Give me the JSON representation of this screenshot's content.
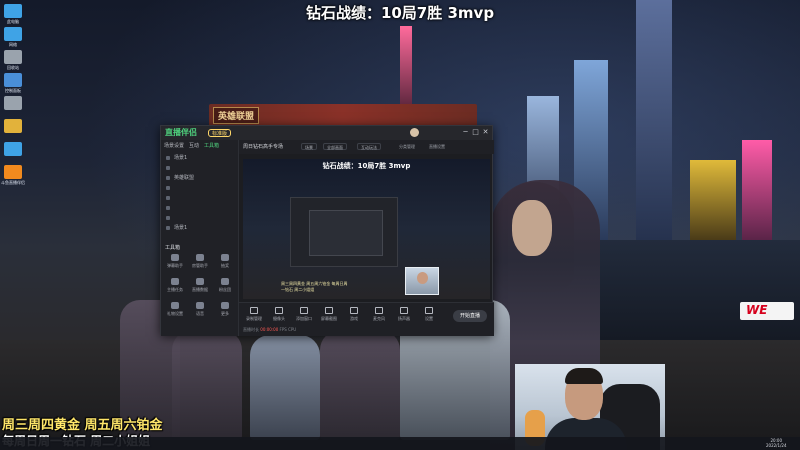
{
  "overlay": {
    "top_title": "钻石战绩：10局7胜  3mvp",
    "promo_line1": "周三周四黄金 周五周六铂金",
    "promo_line2": "每周日周一钻石 周二小姐姐"
  },
  "desktop": {
    "icons": [
      {
        "label": "此电脑",
        "color": "#3fa3e6"
      },
      {
        "label": "网络",
        "color": "#3fa3e6"
      },
      {
        "label": "回收站",
        "color": "#9aa3ad"
      },
      {
        "label": "控制面板",
        "color": "#4a8fd9"
      },
      {
        "label": "",
        "color": "#9aa3ad"
      },
      {
        "label": "",
        "color": "#e2b23b"
      },
      {
        "label": "",
        "color": "#3fa3e6"
      },
      {
        "label": "斗鱼直播伴侣",
        "color": "#f28a1e"
      }
    ]
  },
  "game_window": {
    "logo_text": "英雄联盟"
  },
  "app": {
    "logo": "直播伴侣",
    "badge": "标准版",
    "window_controls": [
      "─",
      "□",
      "✕"
    ],
    "sidebar": {
      "tabs": [
        "场景设置",
        "互动",
        "工具箱"
      ],
      "items": [
        "场景1",
        "",
        "英雄联盟",
        "",
        "",
        "",
        "",
        "场景1"
      ],
      "tools_title": "工具箱",
      "tools": [
        {
          "label": "弹幕助手"
        },
        {
          "label": "房管助手"
        },
        {
          "label": "抽奖"
        },
        {
          "label": "主播任务"
        },
        {
          "label": "直播数据"
        },
        {
          "label": "粉丝团"
        },
        {
          "label": "礼物设置"
        },
        {
          "label": "语音"
        },
        {
          "label": "更多"
        }
      ]
    },
    "main_top": {
      "scene_name": "周日钻石高手专场",
      "chip1": "场景",
      "chip2": "全部画面",
      "chip3": "互动玩法",
      "tiny1": "分类管理",
      "tiny2": "直播设置"
    },
    "preview": {
      "title": "钻石战绩：10局7胜  3mvp",
      "caption": "周三周四黄金 周五周六铂金 每周日周一钻石 周二小姐姐"
    },
    "bottom_controls": [
      {
        "label": "录制管理"
      },
      {
        "label": "摄像头"
      },
      {
        "label": "添加窗口"
      },
      {
        "label": "屏幕截图"
      },
      {
        "label": "游戏"
      },
      {
        "label": "麦克风"
      },
      {
        "label": "扬声器"
      },
      {
        "label": "设置"
      }
    ],
    "go_live_label": "开始直播",
    "status": {
      "prefix": "直播时长",
      "value": "00:00:00",
      "fps_label": "FPS",
      "cpu_label": "CPU"
    }
  },
  "logos": {
    "team": "WE"
  },
  "taskbar": {
    "time": "20:00",
    "date": "2022/1/24"
  }
}
